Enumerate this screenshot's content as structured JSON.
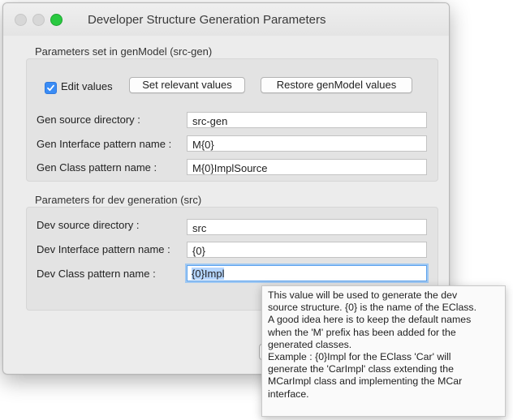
{
  "window": {
    "title": "Developer Structure Generation Parameters"
  },
  "gen_section": {
    "label": "Parameters set in genModel (src-gen)",
    "edit_values_label": "Edit values",
    "edit_values_checked": true,
    "set_relevant_label": "Set relevant values",
    "restore_label": "Restore genModel values",
    "source_dir_label": "Gen source directory :",
    "source_dir_value": "src-gen",
    "interface_label": "Gen Interface pattern name :",
    "interface_value": "M{0}",
    "class_label": "Gen Class pattern name :",
    "class_value": "M{0}ImplSource"
  },
  "dev_section": {
    "label": "Parameters for dev generation (src)",
    "source_dir_label": "Dev source directory :",
    "source_dir_value": "src",
    "interface_label": "Dev Interface pattern name :",
    "interface_value": "{0}",
    "class_label": "Dev Class pattern name :",
    "class_value": "{0}Impl"
  },
  "tooltip": {
    "lines": [
      "This value will be used to generate the dev",
      "source structure. {0} is the name of the EClass.",
      "A good idea here is to keep the default names",
      "when the 'M' prefix has been added for the",
      "generated classes.",
      "Example : {0}Impl  for the EClass 'Car' will",
      "generate the 'CarImpl' class extending the",
      "MCarImpl class and implementing the MCar",
      "interface."
    ]
  },
  "colors": {
    "accent": "#3a8cf5",
    "focus_ring": "#9fc8f2",
    "selection": "#b4d5fe",
    "window_bg": "#ececec",
    "group_bg": "#e3e3e3"
  }
}
